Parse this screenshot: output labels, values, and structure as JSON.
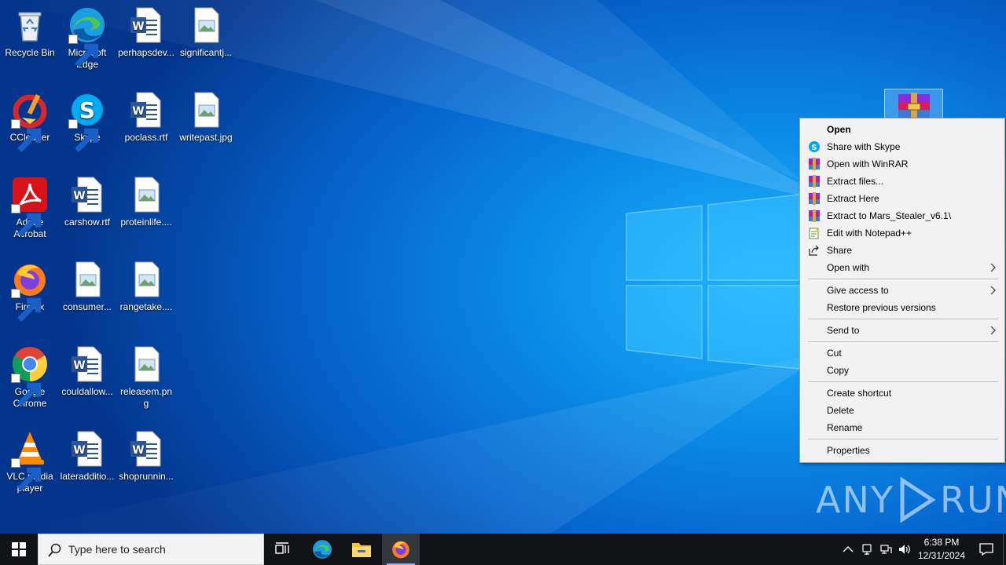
{
  "desktop": {
    "icons": [
      {
        "label": "Recycle Bin",
        "icon": "recycle-bin-icon"
      },
      {
        "label": "Microsoft Edge",
        "icon": "edge-icon"
      },
      {
        "label": "perhapsdev...",
        "icon": "word-doc-icon"
      },
      {
        "label": "significantj...",
        "icon": "image-file-icon"
      },
      {
        "label": "CCleaner",
        "icon": "ccleaner-icon"
      },
      {
        "label": "Skype",
        "icon": "skype-icon"
      },
      {
        "label": "poclass.rtf",
        "icon": "word-doc-icon"
      },
      {
        "label": "writepast.jpg",
        "icon": "image-file-icon"
      },
      {
        "label": "Adobe Acrobat",
        "icon": "acrobat-icon"
      },
      {
        "label": "carshow.rtf",
        "icon": "word-doc-icon"
      },
      {
        "label": "proteinlife....",
        "icon": "image-file-icon"
      },
      {
        "label": "Firefox",
        "icon": "firefox-icon"
      },
      {
        "label": "consumer...",
        "icon": "image-file-icon"
      },
      {
        "label": "rangetake....",
        "icon": "image-file-icon"
      },
      {
        "label": "Google Chrome",
        "icon": "chrome-icon"
      },
      {
        "label": "couldallow...",
        "icon": "word-doc-icon"
      },
      {
        "label": "releasem.png",
        "icon": "image-file-icon"
      },
      {
        "label": "VLC media player",
        "icon": "vlc-icon"
      },
      {
        "label": "lateradditio...",
        "icon": "word-doc-icon"
      },
      {
        "label": "shoprunnin...",
        "icon": "word-doc-icon"
      }
    ],
    "selected_file_icon": "winrar-archive-icon"
  },
  "context_menu": {
    "items": [
      {
        "label": "Open",
        "icon": "",
        "bold": true
      },
      {
        "label": "Share with Skype",
        "icon": "skype-icon"
      },
      {
        "label": "Open with WinRAR",
        "icon": "winrar-icon"
      },
      {
        "label": "Extract files...",
        "icon": "winrar-icon"
      },
      {
        "label": "Extract Here",
        "icon": "winrar-icon"
      },
      {
        "label": "Extract to Mars_Stealer_v6.1\\",
        "icon": "winrar-icon"
      },
      {
        "label": "Edit with Notepad++",
        "icon": "notepadpp-icon"
      },
      {
        "label": "Share",
        "icon": "share-icon"
      },
      {
        "label": "Open with",
        "icon": "",
        "submenu": true
      },
      {
        "label": "Give access to",
        "icon": "",
        "submenu": true
      },
      {
        "label": "Restore previous versions",
        "icon": ""
      },
      {
        "label": "Send to",
        "icon": "",
        "submenu": true
      },
      {
        "label": "Cut",
        "icon": ""
      },
      {
        "label": "Copy",
        "icon": ""
      },
      {
        "label": "Create shortcut",
        "icon": ""
      },
      {
        "label": "Delete",
        "icon": ""
      },
      {
        "label": "Rename",
        "icon": ""
      },
      {
        "label": "Properties",
        "icon": ""
      }
    ]
  },
  "taskbar": {
    "search_placeholder": "Type here to search",
    "pinned": [
      "task-view-icon",
      "edge-icon",
      "file-explorer-icon",
      "firefox-icon"
    ],
    "tray": [
      "chevron-up-icon",
      "usb-icon",
      "network-icon",
      "volume-icon"
    ],
    "time": "6:38 PM",
    "date": "12/31/2024"
  },
  "watermark": {
    "left": "ANY",
    "right": "RUN"
  },
  "colors": {
    "taskbar": "#111317",
    "menu_bg": "#f2f2f2",
    "accent": "#0078d7"
  }
}
